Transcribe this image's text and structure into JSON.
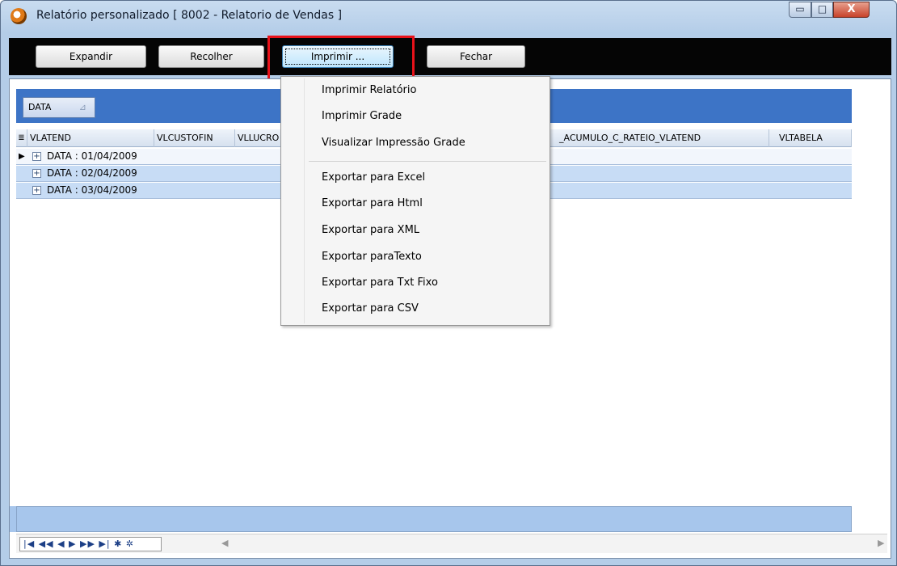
{
  "window": {
    "title": "Relatório personalizado  [ 8002 - Relatorio de Vendas ]",
    "min_label": "▭",
    "max_label": "□",
    "close_label": "X"
  },
  "toolbar": {
    "expandir": "Expandir",
    "recolher": "Recolher",
    "imprimir": "Imprimir ...",
    "fechar": "Fechar"
  },
  "groupbar": {
    "chip_label": "DATA",
    "sort_glyph": "⊿"
  },
  "grid": {
    "columns": {
      "selector": "≣",
      "vlatend": "VLATEND",
      "vlcustofin": "VLCUSTOFIN",
      "vllucro": "VLLUCRO",
      "acumulo": "_ACUMULO_C_RATEIO_VLATEND",
      "vltabela": "VLTABELA"
    },
    "rows": [
      {
        "label": "DATA : 01/04/2009"
      },
      {
        "label": "DATA : 02/04/2009"
      },
      {
        "label": "DATA : 03/04/2009"
      }
    ]
  },
  "menu": {
    "items": [
      "Imprimir Relatório",
      "Imprimir Grade",
      "Visualizar Impressão Grade",
      "Exportar para Excel",
      "Exportar para Html",
      "Exportar para XML",
      "Exportar paraTexto",
      "Exportar para Txt Fixo",
      "Exportar para CSV"
    ]
  },
  "navigator": {
    "buttons": "|◀ ◀◀ ◀ ▶ ▶▶ ▶| ✱ ✲"
  },
  "colors": {
    "highlight": "#e8121a",
    "groupbar": "#3d74c6",
    "row_alt": "#c7dcf5"
  }
}
